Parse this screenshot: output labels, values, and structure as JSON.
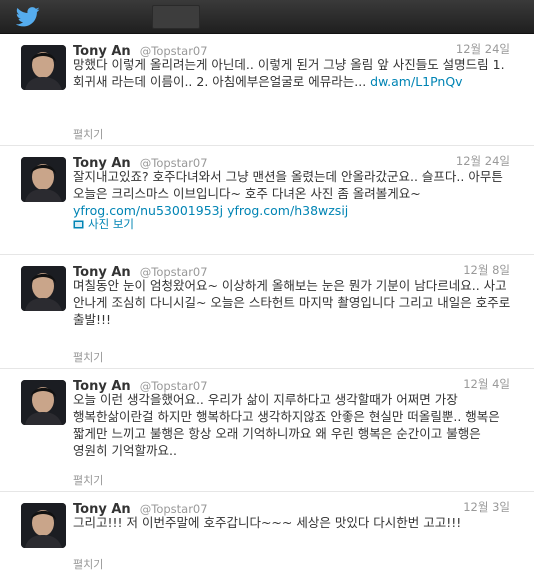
{
  "brand_color": "#55acee",
  "link_color": "#0084b4",
  "tweets": [
    {
      "name": "Tony An",
      "handle": "@Topstar07",
      "time": "12월 24일",
      "text": "망했다 이렇게 올리려는게 아닌데.. 이렇게 된거 그냥 올림 앞 사진들도 설명드림 1. 회귀새 라는데 이름이.. 2. 아침에부은얼굴로 에뮤라는...",
      "link": "dw.am/L1PnQv",
      "action": "펼치기"
    },
    {
      "name": "Tony An",
      "handle": "@Topstar07",
      "time": "12월 24일",
      "text": "잘지내고있죠? 호주다녀와서 그냥 맨션을 올렸는데 안올라갔군요.. 슬프다.. 아무튼 오늘은 크리스마스 이브입니다~ 호주 다녀온 사진 좀 올려볼게요~",
      "link1": "yfrog.com/nu53001953j",
      "link2": "yfrog.com/h38wzsij",
      "photo_label": "사진 보기"
    },
    {
      "name": "Tony An",
      "handle": "@Topstar07",
      "time": "12월 8일",
      "text": "며칠동안 눈이 엄청왔어요~ 이상하게 올해보는 눈은 뭔가 기분이 남다르네요.. 사고 안나게 조심히 다니시길~ 오늘은 스타헌트 마지막 촬영입니다 그리고 내일은 호주로 출발!!!",
      "action": "펼치기"
    },
    {
      "name": "Tony An",
      "handle": "@Topstar07",
      "time": "12월 4일",
      "text": "오늘 이런 생각을했어요.. 우리가 삶이 지루하다고 생각할때가 어쩌면 가장 행복한삶이란걸 하지만 행복하다고 생각하지않죠 안좋은 현실만 떠올릴뿐.. 행복은 짧게만 느끼고 불행은 항상 오래 기억하니까요 왜 우린 행복은 순간이고 불행은 영원히 기억할까요..",
      "action": "펼치기"
    },
    {
      "name": "Tony An",
      "handle": "@Topstar07",
      "time": "12월 3일",
      "text": "그리고!!! 저 이번주말에 호주갑니다~~~ 세상은 맛있다 다시한번 고고!!!",
      "action": "펼치기"
    }
  ]
}
